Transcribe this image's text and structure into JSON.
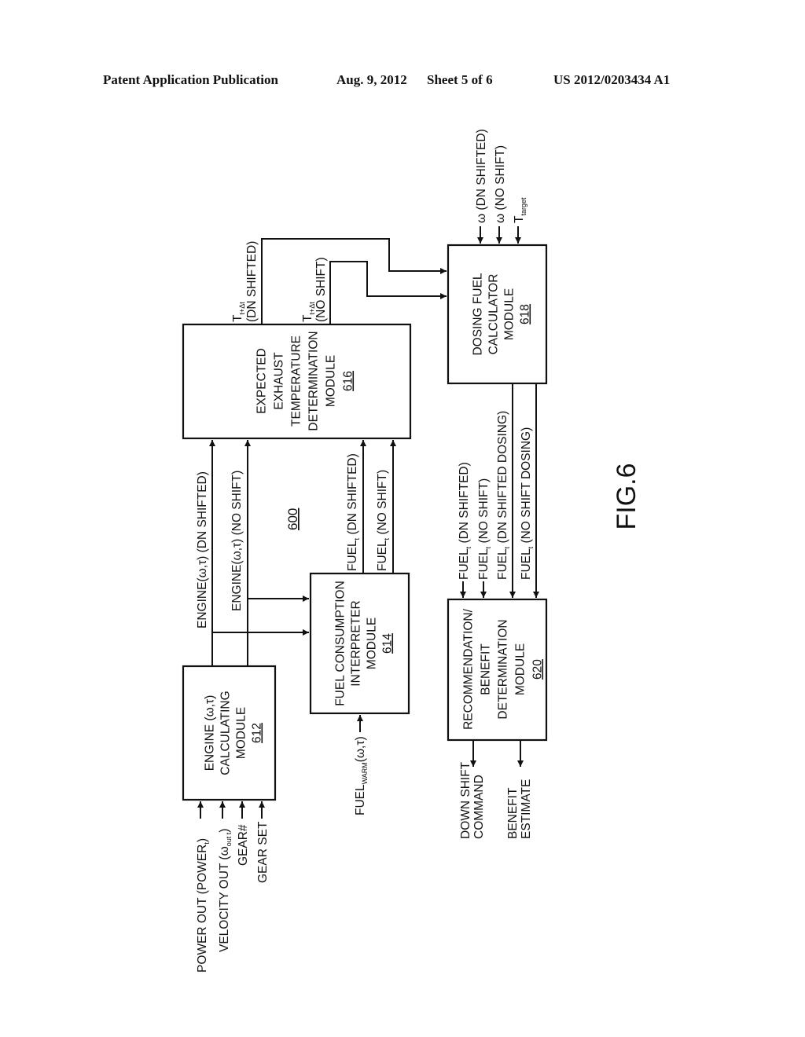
{
  "header": {
    "publication": "Patent Application Publication",
    "date": "Aug. 9, 2012",
    "sheet": "Sheet 5 of 6",
    "number": "US 2012/0203434 A1"
  },
  "figure": {
    "label": "FIG.6",
    "ref": "600"
  },
  "modules": {
    "m612": {
      "lines": [
        "ENGINE (ω,τ)",
        "CALCULATING",
        "MODULE"
      ],
      "ref": "612"
    },
    "m614": {
      "lines": [
        "FUEL CONSUMPTION",
        "INTERPRETER",
        "MODULE"
      ],
      "ref": "614"
    },
    "m616": {
      "lines": [
        "EXPECTED",
        "EXHAUST",
        "TEMPERATURE",
        "DETERMINATION",
        "MODULE"
      ],
      "ref": "616"
    },
    "m618": {
      "lines": [
        "DOSING FUEL",
        "CALCULATOR",
        "MODULE"
      ],
      "ref": "618"
    },
    "m620": {
      "lines": [
        "RECOMMENDATION/",
        "BENEFIT",
        "DETERMINATION",
        "MODULE"
      ],
      "ref": "620"
    }
  },
  "inputs_612": [
    {
      "main": "POWER OUT (POWER",
      "sub": "t",
      "tail": ")"
    },
    {
      "main": "VELOCITY OUT (ω",
      "sub": "out t",
      "tail": ")"
    },
    {
      "main": "GEAR#",
      "sub": "",
      "tail": ""
    },
    {
      "main": "GEAR SET",
      "sub": "",
      "tail": ""
    }
  ],
  "input_614": {
    "main": "FUEL",
    "sub": "WARM",
    "tail": "(ω,τ)"
  },
  "engine_signals": [
    {
      "text": "ENGINE(ω,τ) (DN SHIFTED)"
    },
    {
      "text": "ENGINE(ω,τ) (NO SHIFT)"
    }
  ],
  "fuel_signals": [
    {
      "main": "FUEL",
      "sub": "t",
      "tail": " (DN SHIFTED)"
    },
    {
      "main": "FUEL",
      "sub": "t",
      "tail": " (NO SHIFT)"
    }
  ],
  "temp_signals": [
    {
      "main": "T",
      "sub": "t+Δt",
      "tail": "(DN SHIFTED)"
    },
    {
      "main": "T",
      "sub": "t+Δt",
      "tail": "(NO SHIFT)"
    }
  ],
  "inputs_618": [
    {
      "main": "ω (DN SHIFTED)",
      "sub": ""
    },
    {
      "main": "ω (NO SHIFT)",
      "sub": ""
    },
    {
      "main": "T",
      "sub": "target"
    }
  ],
  "inputs_620": [
    {
      "main": "FUEL",
      "sub": "t",
      "tail": " (DN SHIFTED)"
    },
    {
      "main": "FUEL",
      "sub": "t",
      "tail": " (NO SHIFT)"
    },
    {
      "main": "FUEL",
      "sub": "t",
      "tail": " (DN SHIFTED DOSING)"
    },
    {
      "main": "FUEL",
      "sub": "t",
      "tail": " (NO SHIFT DOSING)"
    }
  ],
  "outputs_620": [
    {
      "lines": [
        "DOWN SHIFT",
        "COMMAND"
      ]
    },
    {
      "lines": [
        "BENEFIT",
        "ESTIMATE"
      ]
    }
  ]
}
